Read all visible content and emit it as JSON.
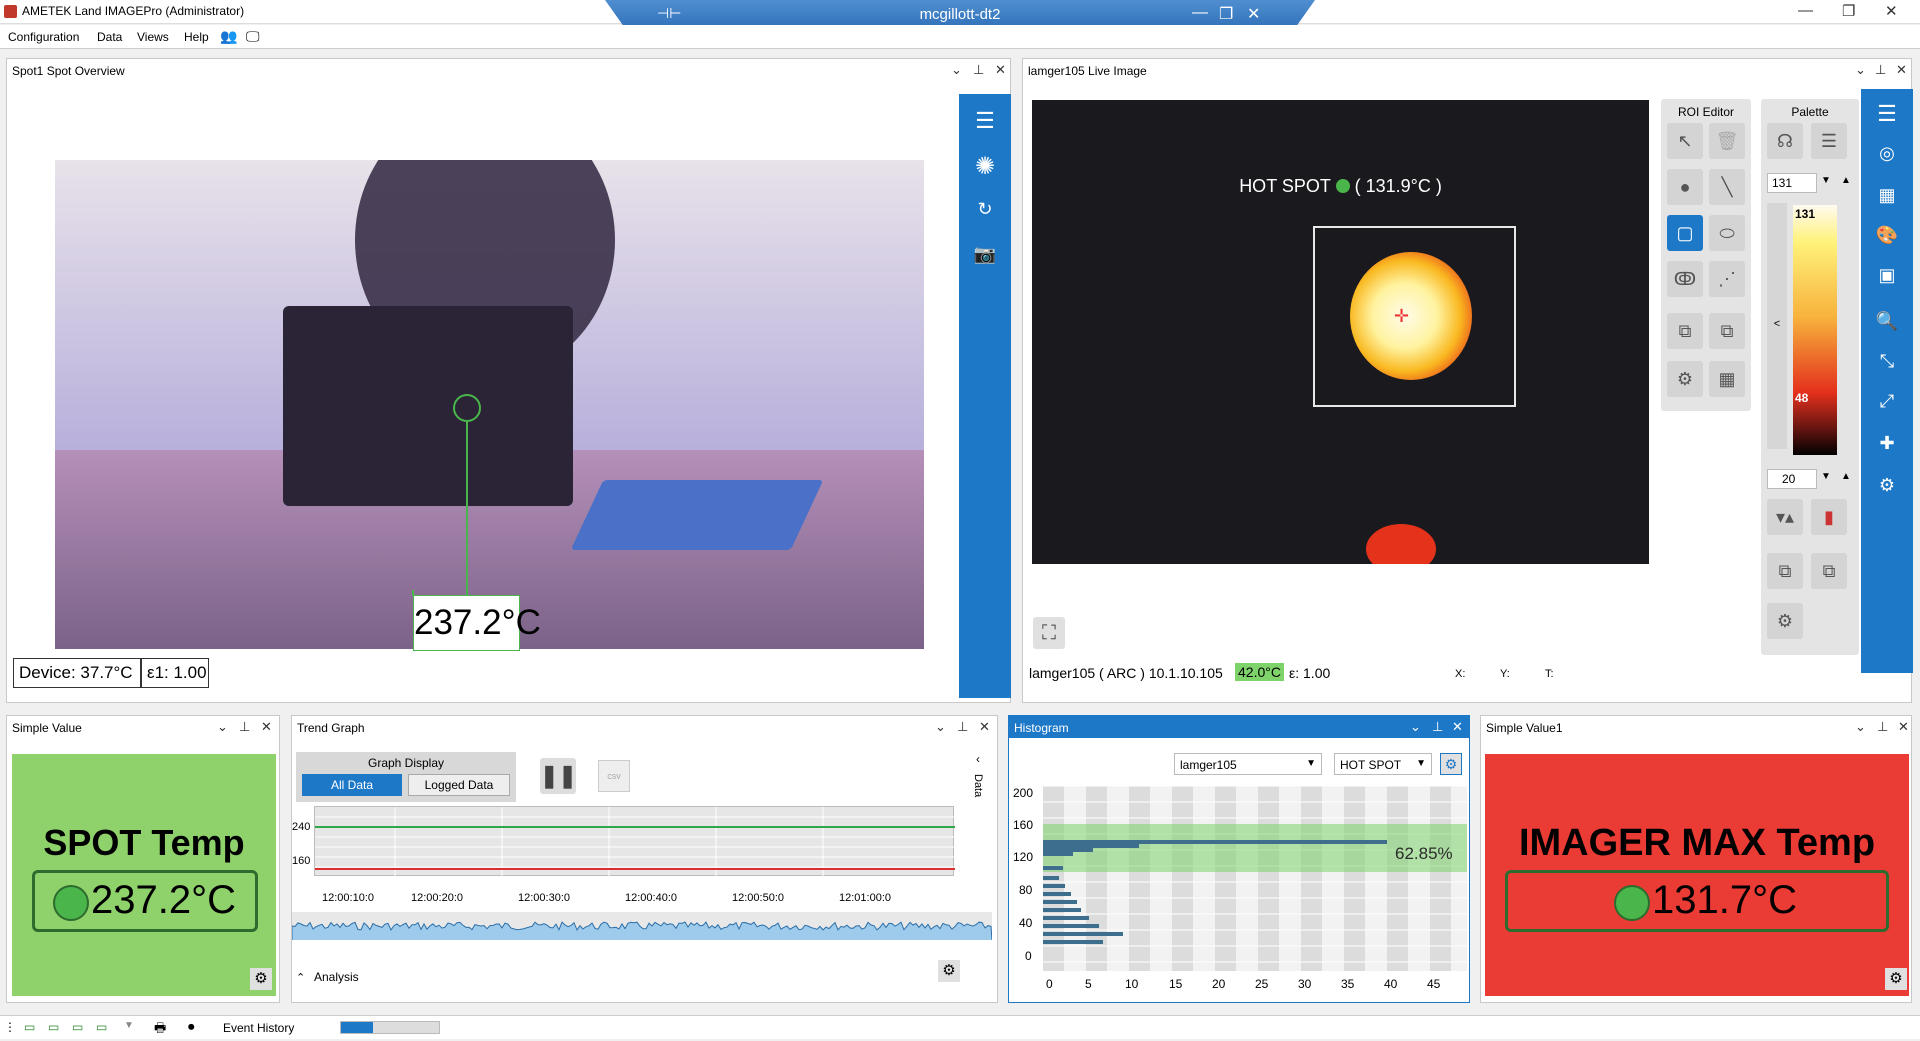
{
  "app": {
    "title": "AMETEK Land IMAGEPro (Administrator)",
    "remote_title": "mcgillott-dt2"
  },
  "menu": [
    "Configuration",
    "Data",
    "Views",
    "Help"
  ],
  "spot_overview": {
    "title": "Spot1 Spot Overview",
    "reading": "237.2°C",
    "device": "Device: 37.7°C",
    "emissivity": "ε1: 1.00"
  },
  "live_image": {
    "title": "lamger105 Live Image",
    "hotspot_label": "HOT SPOT",
    "hotspot_value": "( 131.9°C )",
    "info": "lamger105 ( ARC ) 10.1.10.105",
    "temp_badge": "42.0°C",
    "emissivity": "ε: 1.00",
    "x_label": "X:",
    "y_label": "Y:",
    "t_label": "T:"
  },
  "roi_editor": {
    "title": "ROI Editor"
  },
  "palette": {
    "title": "Palette",
    "max_input": "131",
    "min_input": "20",
    "scale_top": "131",
    "scale_low": "48",
    "collapse": "<"
  },
  "simple_value": {
    "title": "Simple Value",
    "label": "SPOT Temp",
    "value": "237.2°C"
  },
  "trend": {
    "title": "Trend Graph",
    "graph_display": "Graph Display",
    "all_data": "All Data",
    "logged_data": "Logged Data",
    "side_tab": "Data",
    "y_ticks": [
      "240",
      "160"
    ],
    "x_ticks": [
      "12:00:10:0",
      "12:00:20:0",
      "12:00:30:0",
      "12:00:40:0",
      "12:00:50:0",
      "12:01:00:0"
    ],
    "analysis": "Analysis",
    "colors": {
      "upper": "#2ea84a",
      "lower": "#d93030"
    }
  },
  "histogram": {
    "title": "Histogram",
    "device_select": "lamger105",
    "roi_select": "HOT SPOT",
    "y_ticks": [
      "200",
      "160",
      "120",
      "80",
      "40",
      "0"
    ],
    "x_ticks": [
      "0",
      "5",
      "10",
      "15",
      "20",
      "25",
      "30",
      "35",
      "40",
      "45"
    ],
    "percent": "62.85%"
  },
  "simple_value1": {
    "title": "Simple Value1",
    "label": "IMAGER MAX Temp",
    "value": "131.7°C"
  },
  "status": {
    "event_history": "Event History"
  },
  "colors": {
    "accent": "#1e78c8",
    "green_tile": "#8fd16a",
    "red_tile": "#ea3b35"
  }
}
